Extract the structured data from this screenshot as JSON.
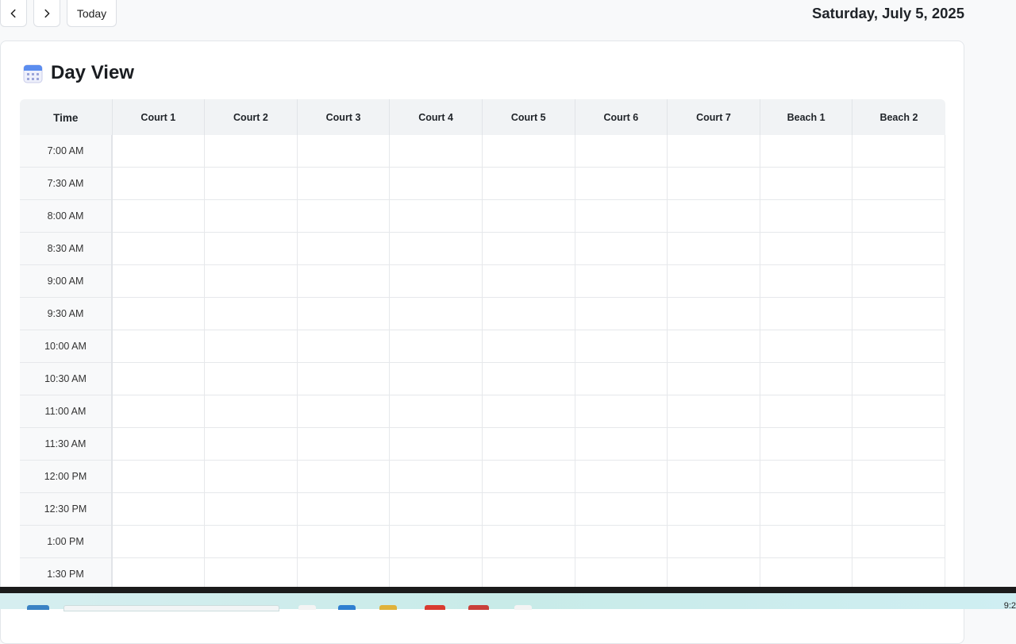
{
  "toolbar": {
    "today_label": "Today",
    "date_title": "Saturday, July 5, 2025"
  },
  "card": {
    "title": "Day View"
  },
  "grid": {
    "time_header": "Time",
    "columns": [
      "Court 1",
      "Court 2",
      "Court 3",
      "Court 4",
      "Court 5",
      "Court 6",
      "Court 7",
      "Beach 1",
      "Beach 2"
    ],
    "times": [
      "7:00 AM",
      "7:30 AM",
      "8:00 AM",
      "8:30 AM",
      "9:00 AM",
      "9:30 AM",
      "10:00 AM",
      "10:30 AM",
      "11:00 AM",
      "11:30 AM",
      "12:00 PM",
      "12:30 PM",
      "1:00 PM",
      "1:30 PM"
    ]
  },
  "taskbar": {
    "clock": "9:2"
  }
}
